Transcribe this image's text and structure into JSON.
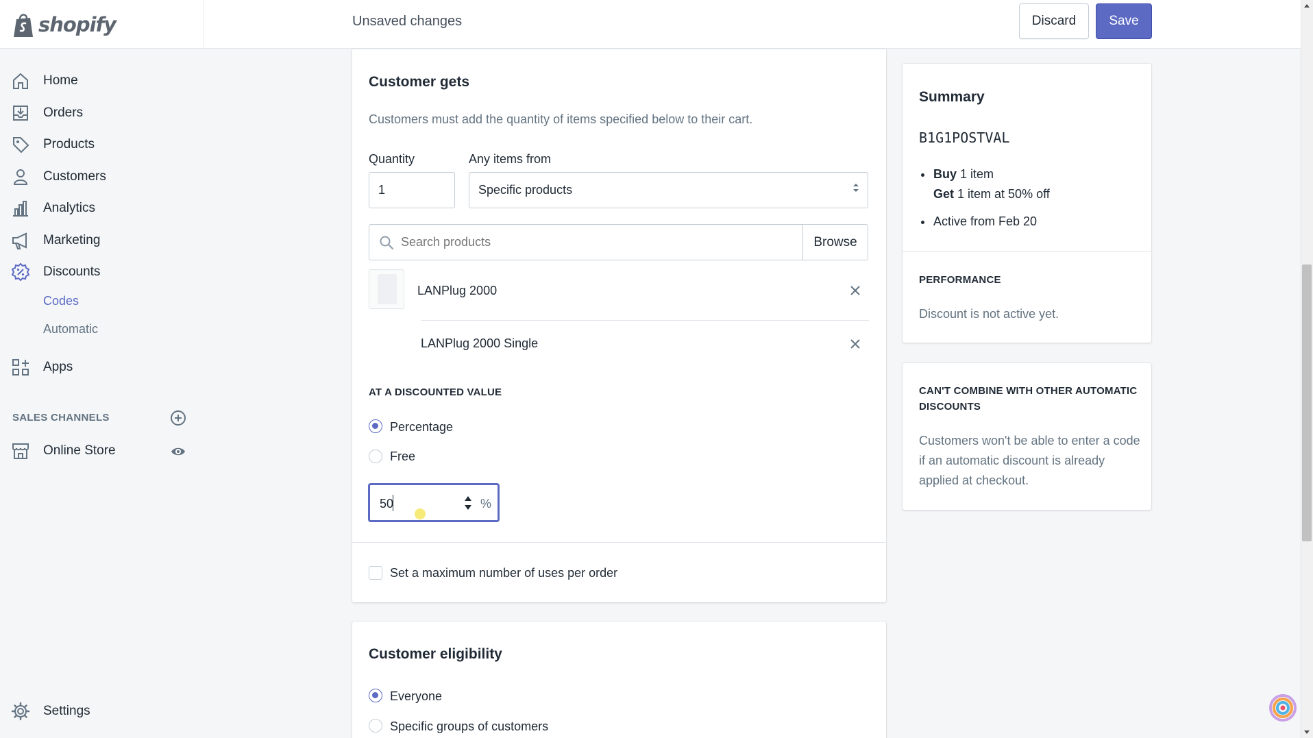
{
  "topbar": {
    "brand": "shopify",
    "status": "Unsaved changes",
    "discard_label": "Discard",
    "save_label": "Save"
  },
  "sidebar": {
    "items": [
      {
        "label": "Home",
        "icon": "home-icon"
      },
      {
        "label": "Orders",
        "icon": "orders-icon"
      },
      {
        "label": "Products",
        "icon": "tag-icon"
      },
      {
        "label": "Customers",
        "icon": "person-icon"
      },
      {
        "label": "Analytics",
        "icon": "bar-chart-icon"
      },
      {
        "label": "Marketing",
        "icon": "megaphone-icon"
      },
      {
        "label": "Discounts",
        "icon": "discount-badge-icon"
      }
    ],
    "discount_subitems": [
      "Codes",
      "Automatic"
    ],
    "apps_label": "Apps",
    "sales_channels_title": "SALES CHANNELS",
    "online_store_label": "Online Store",
    "settings_label": "Settings"
  },
  "customer_gets": {
    "title": "Customer gets",
    "description": "Customers must add the quantity of items specified below to their cart.",
    "quantity_label": "Quantity",
    "quantity_value": "1",
    "any_items_label": "Any items from",
    "any_items_value": "Specific products",
    "search_placeholder": "Search products",
    "browse_label": "Browse",
    "product_name": "LANPlug 2000",
    "variant_name": "LANPlug 2000 Single",
    "discounted_value_title": "AT A DISCOUNTED VALUE",
    "option_percentage": "Percentage",
    "option_free": "Free",
    "percentage_value": "50",
    "percent_symbol": "%",
    "max_uses_label": "Set a maximum number of uses per order"
  },
  "eligibility": {
    "title": "Customer eligibility",
    "option_everyone": "Everyone",
    "option_groups": "Specific groups of customers"
  },
  "summary": {
    "title": "Summary",
    "code": "B1G1POSTVAL",
    "buy_bold": "Buy",
    "buy_rest": " 1 item",
    "get_bold": "Get",
    "get_rest": " 1 item at 50% off",
    "active_from": "Active from Feb 20",
    "performance_title": "PERFORMANCE",
    "performance_text": "Discount is not active yet."
  },
  "combine": {
    "title_line1": "CAN'T COMBINE WITH OTHER AUTOMATIC",
    "title_line2": "DISCOUNTS",
    "text_line1": "Customers won't be able to enter a code",
    "text_line2": "if an automatic discount is already",
    "text_line3": "applied at checkout."
  },
  "colors": {
    "accent": "#5c6ac4",
    "text": "#212b36",
    "muted": "#637381",
    "background": "#f4f6f8"
  }
}
